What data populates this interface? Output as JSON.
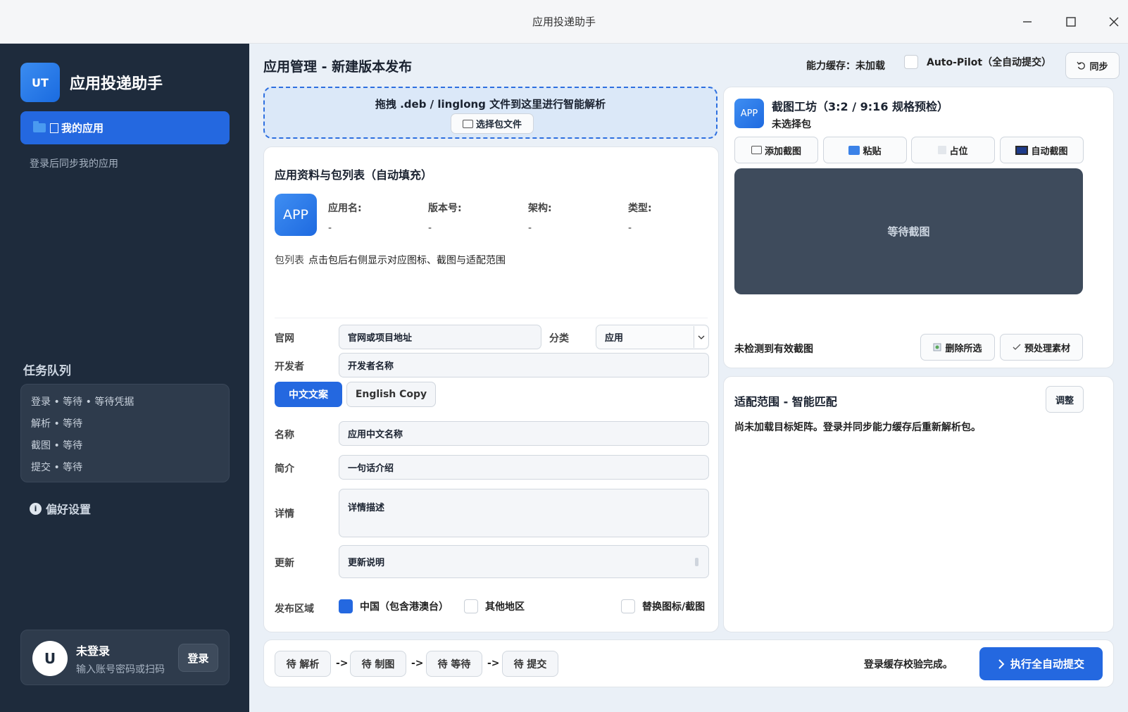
{
  "window": {
    "title": "应用投递助手",
    "controls": [
      "minimize-icon",
      "maximize-icon",
      "close-icon"
    ]
  },
  "sidebar": {
    "logo": "UT",
    "app_name": "应用投递助手",
    "nav_active": "我的应用",
    "sync_hint": "登录后同步我的应用",
    "queue_title": "任务队列",
    "queue": [
      "登录 • 等待 • 等待凭据",
      "解析 • 等待",
      "截图 • 等待",
      "提交 • 等待"
    ],
    "prefs": "偏好设置",
    "user": {
      "avatar": "U",
      "name": "未登录",
      "sub": "输入账号密码或扫码",
      "login_label": "登录"
    }
  },
  "header": {
    "title": "应用管理 - 新建版本发布",
    "cache_status": "能力缓存：未加载",
    "autopilot_label": "Auto-Pilot（全自动提交）",
    "autopilot_checked": false,
    "sync_label": "同步"
  },
  "dropzone": {
    "text": "拖拽 .deb / linglong 文件到这里进行智能解析",
    "button": "选择包文件"
  },
  "form": {
    "title": "应用资料与包列表（自动填充）",
    "icon_text": "APP",
    "meta": [
      {
        "label": "应用名:",
        "value": "-"
      },
      {
        "label": "版本号:",
        "value": "-"
      },
      {
        "label": "架构:",
        "value": "-"
      },
      {
        "label": "类型:",
        "value": "-"
      }
    ],
    "pkg_label": "包列表",
    "pkg_hint": "点击包后右侧显示对应图标、截图与适配范围",
    "website_label": "官网",
    "website_placeholder": "官网或项目地址",
    "category_label": "分类",
    "category_value": "应用",
    "developer_label": "开发者",
    "developer_placeholder": "开发者名称",
    "tabs": [
      "中文文案",
      "English Copy"
    ],
    "name_label": "名称",
    "name_placeholder": "应用中文名称",
    "intro_label": "简介",
    "intro_placeholder": "一句话介绍",
    "detail_label": "详情",
    "detail_placeholder": "详情描述",
    "update_label": "更新",
    "update_placeholder": "更新说明",
    "region_label": "发布区域",
    "regions": [
      {
        "label": "中国（包含港澳台）",
        "checked": true
      },
      {
        "label": "其他地区",
        "checked": false
      },
      {
        "label": "替换图标/截图",
        "checked": false
      }
    ]
  },
  "screenshots": {
    "icon_text": "APP",
    "title": "截图工坊（3:2 / 9:16 规格预检）",
    "subtitle": "未选择包",
    "tools": [
      "添加截图",
      "粘贴",
      "占位",
      "自动截图"
    ],
    "preview_text": "等待截图",
    "status": "未检测到有效截图",
    "delete_label": "删除所选",
    "preprocess_label": "预处理素材"
  },
  "match": {
    "title": "适配范围 - 智能匹配",
    "text": "尚未加载目标矩阵。登录并同步能力缓存后重新解析包。",
    "adjust_label": "调整"
  },
  "pipeline": {
    "steps": [
      "待 解析",
      "待 制图",
      "待 等待",
      "待 提交"
    ],
    "arrow": "->",
    "status": "登录缓存校验完成。",
    "run_label": "执行全自动提交"
  },
  "colors": {
    "accent": "#2468e0",
    "sidebar_bg": "#1e2b3c",
    "preview_bg": "#3e4b5c"
  }
}
